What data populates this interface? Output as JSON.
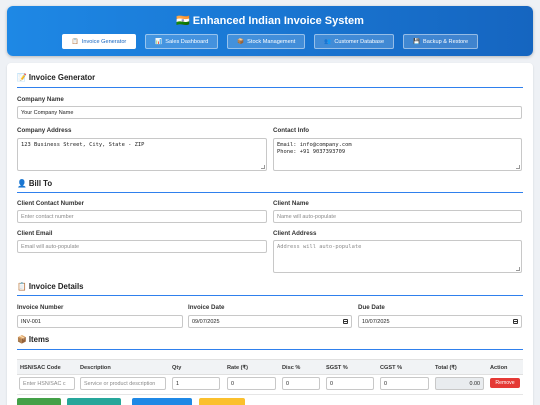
{
  "header": {
    "title": "🇮🇳 Enhanced Indian Invoice System",
    "tabs": [
      {
        "icon": "📋",
        "label": "Invoice Generator"
      },
      {
        "icon": "📊",
        "label": "Sales Dashboard"
      },
      {
        "icon": "📦",
        "label": "Stock Management"
      },
      {
        "icon": "👥",
        "label": "Customer Database"
      },
      {
        "icon": "💾",
        "label": "Backup & Restore"
      }
    ]
  },
  "invoice_generator": {
    "title": "📝 Invoice Generator",
    "company_name_label": "Company Name",
    "company_name_value": "Your Company Name",
    "company_address_label": "Company Address",
    "company_address_value": "123 Business Street, City, State - ZIP",
    "contact_info_label": "Contact Info",
    "contact_info_value": "Email: info@company.com\nPhone: +91 9037393709"
  },
  "bill_to": {
    "title": "👤 Bill To",
    "client_contact_label": "Client Contact Number",
    "client_contact_placeholder": "Enter contact number",
    "client_name_label": "Client Name",
    "client_name_placeholder": "Name will auto-populate",
    "client_email_label": "Client Email",
    "client_email_placeholder": "Email will auto-populate",
    "client_address_label": "Client Address",
    "client_address_placeholder": "Address will auto-populate"
  },
  "invoice_details": {
    "title": "📋 Invoice Details",
    "invoice_number_label": "Invoice Number",
    "invoice_number_value": "INV-001",
    "invoice_date_label": "Invoice Date",
    "invoice_date_value": "09/07/2025",
    "due_date_label": "Due Date",
    "due_date_value": "10/07/2025"
  },
  "items": {
    "title": "📦 Items",
    "columns": [
      "HSN/SAC Code",
      "Description",
      "Qty",
      "Rate (₹)",
      "Disc %",
      "SGST %",
      "CGST %",
      "Total (₹)",
      "Action"
    ],
    "row": {
      "hsn_placeholder": "Enter HSN/SAC c",
      "description_placeholder": "Service or product description",
      "qty": "1",
      "rate": "0",
      "disc": "0",
      "sgst": "0",
      "cgst": "0",
      "total": "0.00",
      "action": "Remove"
    }
  },
  "colors": {
    "header_gradient_start": "#1e88e5",
    "header_gradient_end": "#1565c0",
    "accent": "#2f80ed",
    "remove": "#e53935"
  }
}
